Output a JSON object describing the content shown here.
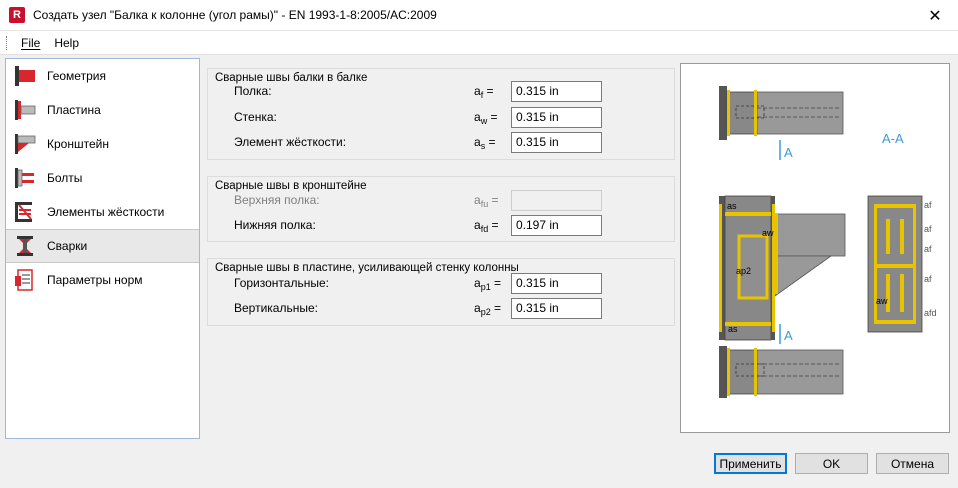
{
  "window": {
    "app_icon_letter": "R",
    "title": "Создать узел \"Балка к колонне (угол рамы)\" - EN 1993-1-8:2005/AC:2009",
    "close_glyph": "✕"
  },
  "menu": {
    "file": "File",
    "help": "Help"
  },
  "nav": {
    "items": [
      {
        "label": "Геометрия",
        "icon": "geometry-icon"
      },
      {
        "label": "Пластина",
        "icon": "plate-icon"
      },
      {
        "label": "Кронштейн",
        "icon": "bracket-icon"
      },
      {
        "label": "Болты",
        "icon": "bolts-icon"
      },
      {
        "label": "Элементы жёсткости",
        "icon": "stiffeners-icon"
      },
      {
        "label": "Сварки",
        "icon": "welds-icon",
        "selected": true
      },
      {
        "label": "Параметры норм",
        "icon": "code-params-icon"
      }
    ]
  },
  "groups": {
    "beam_welds": {
      "title": "Сварные швы балки в балке",
      "rows": [
        {
          "label": "Полка:",
          "sym": "a",
          "sub": "f",
          "value": "0.315 in"
        },
        {
          "label": "Стенка:",
          "sym": "a",
          "sub": "w",
          "value": "0.315 in"
        },
        {
          "label": "Элемент жёсткости:",
          "sym": "a",
          "sub": "s",
          "value": "0.315 in"
        }
      ]
    },
    "bracket_welds": {
      "title": "Сварные швы в кронштейне",
      "rows": [
        {
          "label": "Верхняя полка:",
          "sym": "a",
          "sub": "fu",
          "value": "",
          "disabled": true
        },
        {
          "label": "Нижняя полка:",
          "sym": "a",
          "sub": "fd",
          "value": "0.197 in"
        }
      ]
    },
    "plate_welds": {
      "title": "Сварные швы в пластине, усиливающей стенку колонны",
      "rows": [
        {
          "label": "Горизонтальные:",
          "sym": "a",
          "sub": "p1",
          "value": "0.315 in"
        },
        {
          "label": "Вертикальные:",
          "sym": "a",
          "sub": "p2",
          "value": "0.315 in"
        }
      ]
    }
  },
  "figure": {
    "section_label": "A-A",
    "cut_label_top": "A",
    "cut_label_bottom": "A",
    "accent": "#3a9ad9",
    "weld_color": "#e8c400",
    "steel_color": "#7a7a7a",
    "labels": {
      "as": "as",
      "aw": "aw",
      "ap2": "ap2",
      "as2": "as",
      "af1": "af",
      "af2": "af",
      "af3": "af",
      "af4": "af",
      "aw2": "aw",
      "afd": "afd"
    }
  },
  "buttons": {
    "apply": "Применить",
    "ok": "OK",
    "cancel": "Отмена"
  }
}
